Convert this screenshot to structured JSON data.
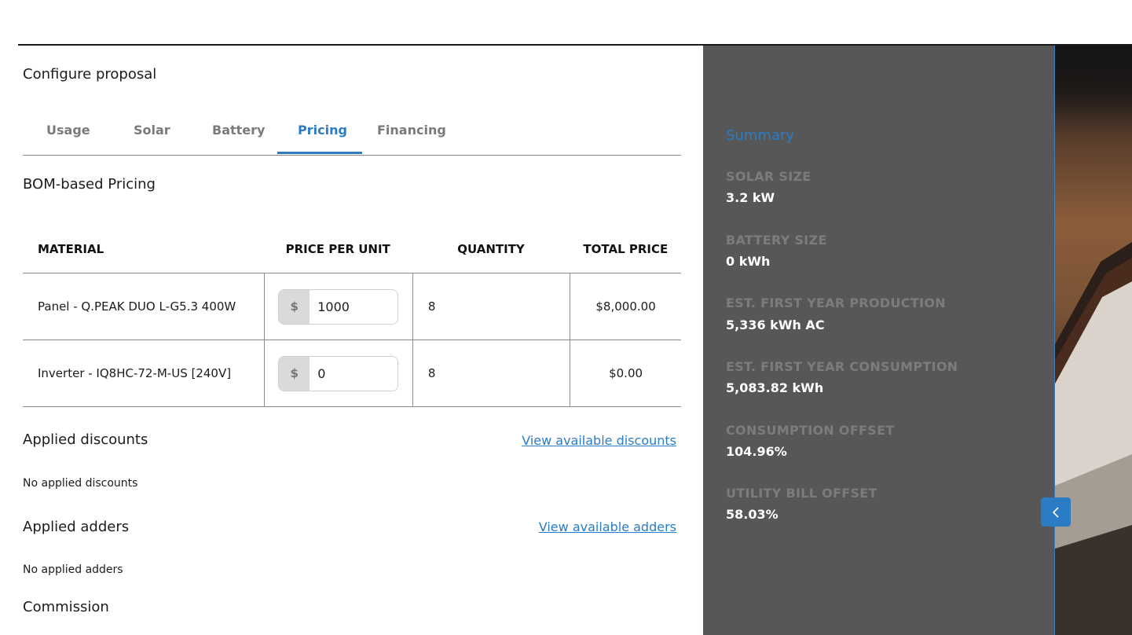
{
  "title": "Configure proposal",
  "tabs": [
    "Usage",
    "Solar",
    "Battery",
    "Pricing",
    "Financing"
  ],
  "active_tab": "Pricing",
  "pricing": {
    "heading": "BOM-based Pricing",
    "columns": [
      "MATERIAL",
      "PRICE PER UNIT",
      "QUANTITY",
      "TOTAL PRICE"
    ],
    "currency_symbol": "$",
    "rows": [
      {
        "material": "Panel - Q.PEAK DUO L-G5.3 400W",
        "price": "1000",
        "quantity": "8",
        "total": "$8,000.00"
      },
      {
        "material": "Inverter - IQ8HC-72-M-US [240V]",
        "price": "0",
        "quantity": "8",
        "total": "$0.00"
      }
    ]
  },
  "discounts": {
    "heading": "Applied discounts",
    "link": "View available discounts",
    "empty": "No applied discounts"
  },
  "adders": {
    "heading": "Applied adders",
    "link": "View available adders",
    "empty": "No applied adders"
  },
  "commission": {
    "heading": "Commission"
  },
  "summary": {
    "title": "Summary",
    "items": [
      {
        "label": "SOLAR SIZE",
        "value": "3.2 kW"
      },
      {
        "label": "BATTERY SIZE",
        "value": "0 kWh"
      },
      {
        "label": "EST. FIRST YEAR PRODUCTION",
        "value": "5,336 kWh AC"
      },
      {
        "label": "EST. FIRST YEAR CONSUMPTION",
        "value": "5,083.82 kWh"
      },
      {
        "label": "CONSUMPTION OFFSET",
        "value": "104.96%"
      },
      {
        "label": "UTILITY BILL OFFSET",
        "value": "58.03%"
      }
    ]
  },
  "colors": {
    "accent": "#2b7cc4",
    "summary_bg": "#575757"
  },
  "icons": {
    "collapse": "chevron-left-icon"
  }
}
